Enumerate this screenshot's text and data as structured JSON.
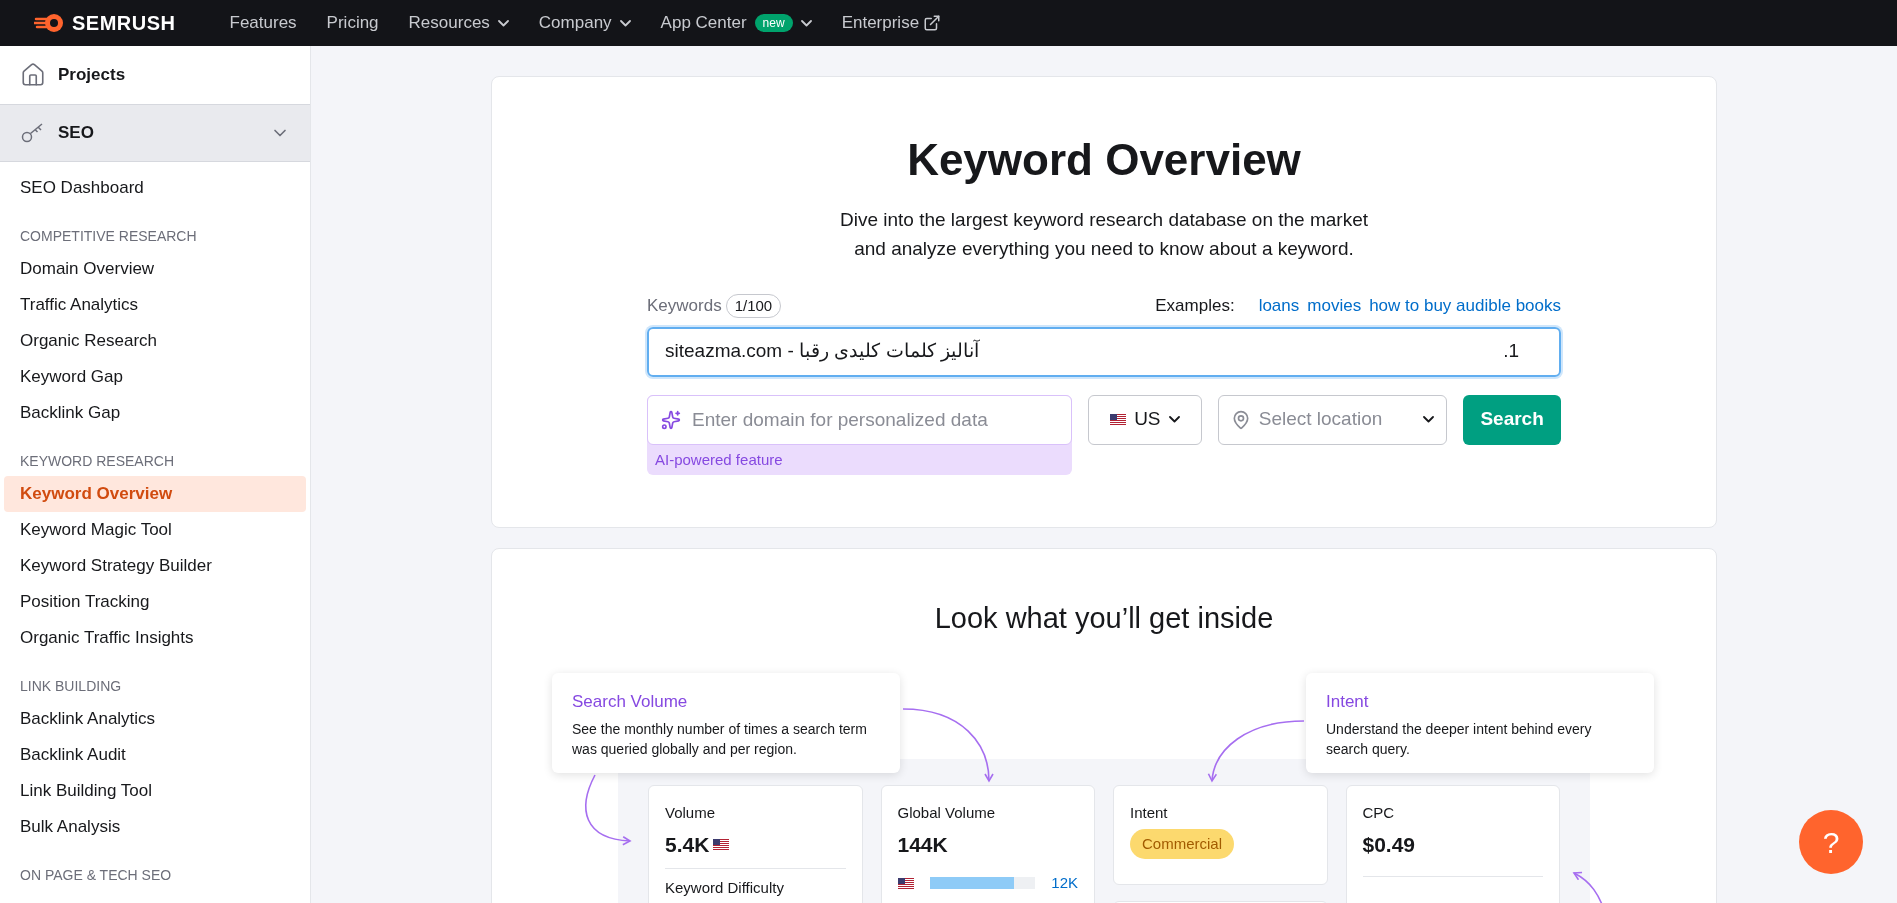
{
  "topbar": {
    "logo": "SEMRUSH",
    "nav": [
      {
        "label": "Features",
        "dropdown": false,
        "external": false
      },
      {
        "label": "Pricing",
        "dropdown": false,
        "external": false
      },
      {
        "label": "Resources",
        "dropdown": true,
        "external": false
      },
      {
        "label": "Company",
        "dropdown": true,
        "external": false
      },
      {
        "label": "App Center",
        "badge": "new",
        "dropdown": true,
        "external": false
      },
      {
        "label": "Enterprise",
        "dropdown": false,
        "external": true
      }
    ]
  },
  "sidebar": {
    "projects": "Projects",
    "seo": {
      "label": "SEO",
      "expanded": true
    },
    "sections": [
      {
        "items": [
          {
            "label": "SEO Dashboard",
            "selected": false
          }
        ]
      },
      {
        "heading": "COMPETITIVE RESEARCH",
        "items": [
          {
            "label": "Domain Overview",
            "selected": false
          },
          {
            "label": "Traffic Analytics",
            "selected": false
          },
          {
            "label": "Organic Research",
            "selected": false
          },
          {
            "label": "Keyword Gap",
            "selected": false
          },
          {
            "label": "Backlink Gap",
            "selected": false
          }
        ]
      },
      {
        "heading": "KEYWORD RESEARCH",
        "items": [
          {
            "label": "Keyword Overview",
            "selected": true
          },
          {
            "label": "Keyword Magic Tool",
            "selected": false
          },
          {
            "label": "Keyword Strategy Builder",
            "selected": false
          },
          {
            "label": "Position Tracking",
            "selected": false
          },
          {
            "label": "Organic Traffic Insights",
            "selected": false
          }
        ]
      },
      {
        "heading": "LINK BUILDING",
        "items": [
          {
            "label": "Backlink Analytics",
            "selected": false
          },
          {
            "label": "Backlink Audit",
            "selected": false
          },
          {
            "label": "Link Building Tool",
            "selected": false
          },
          {
            "label": "Bulk Analysis",
            "selected": false
          }
        ]
      },
      {
        "heading": "ON PAGE & TECH SEO"
      }
    ]
  },
  "hero": {
    "title": "Keyword Overview",
    "subtitle_lines": [
      "Dive into the largest keyword research database on the market",
      "and analyze everything you need to know about a keyword."
    ],
    "keywords_label": "Keywords",
    "keywords_count": "1/100",
    "examples_label": "Examples:",
    "examples": [
      "loans",
      "movies",
      "how to buy audible books"
    ],
    "keyword_value": "siteazma.com - آنالیز کلمات کلیدی رقبا",
    "line_marker": ".1",
    "domain_placeholder": "Enter domain for personalized data",
    "ai_note": "AI-powered feature",
    "country": "US",
    "location_placeholder": "Select location",
    "search_button": "Search"
  },
  "inside": {
    "title": "Look what you’ll get inside",
    "callouts": [
      {
        "title": "Search Volume",
        "text": "See the monthly number of times a search term was queried globally and per region."
      },
      {
        "title": "Intent",
        "text": "Understand the deeper intent behind every search query."
      }
    ],
    "cards": [
      {
        "kind": "volume",
        "label": "Volume",
        "value": "5.4K",
        "sub_label": "Keyword Difficulty"
      },
      {
        "kind": "global",
        "label": "Global Volume",
        "value": "144K",
        "level": 0.8,
        "reading": "12K"
      },
      {
        "kind": "intent",
        "label": "Intent",
        "tag": "Commercial"
      },
      {
        "kind": "cpc",
        "label": "CPC",
        "value": "$0.49"
      }
    ]
  },
  "help": "?"
}
